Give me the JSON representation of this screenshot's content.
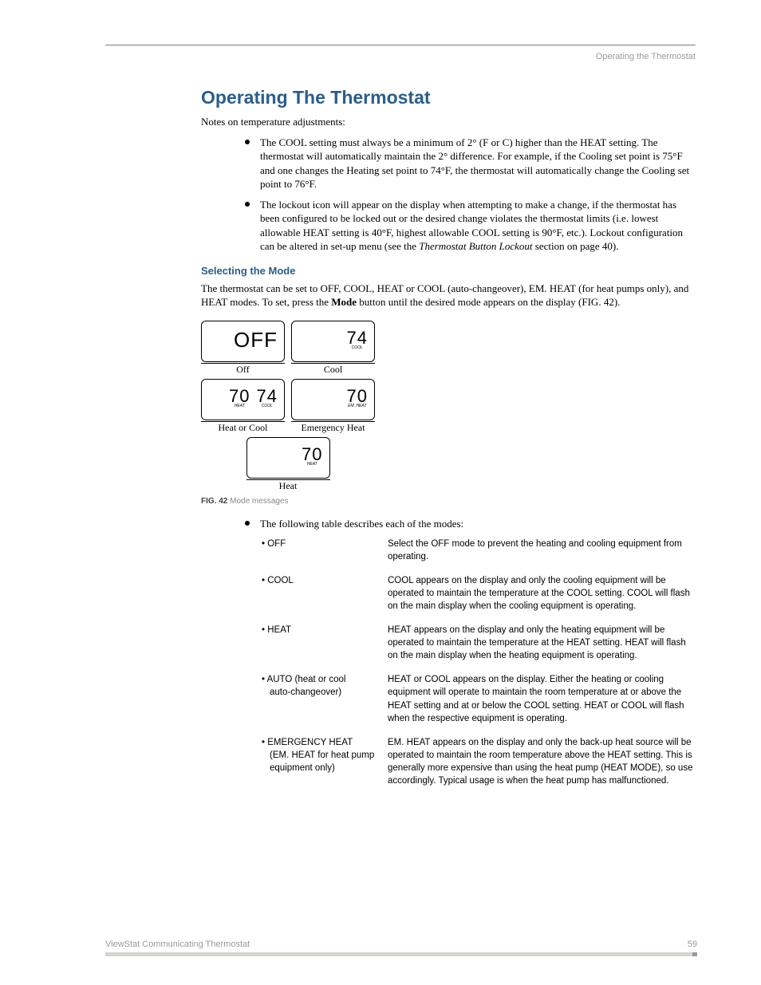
{
  "header": {
    "running_title": "Operating the Thermostat"
  },
  "title": "Operating The Thermostat",
  "intro": "Notes on temperature adjustments:",
  "bullets": [
    "The COOL setting must always be a minimum of 2° (F or C) higher than the HEAT setting. The thermostat will automatically maintain the 2° difference. For example, if the Cooling set point is 75°F and one changes the Heating set point to 74°F, the thermostat will automatically change the Cooling set point to 76°F.",
    "The lockout icon will appear on the display when attempting to make a change, if the thermostat has been configured to be locked out or the desired change violates the thermostat limits (i.e. lowest allowable HEAT setting is 40°F, highest allowable COOL setting is 90°F, etc.). Lockout configuration can be altered in set-up menu (see the ",
    " section on page 40)."
  ],
  "bullet2_italic": "Thermostat Button Lockout",
  "section2_heading": "Selecting the Mode",
  "section2_p1a": "The thermostat can be set to OFF, COOL, HEAT or COOL (auto-changeover), EM. HEAT (for heat pumps only), and HEAT modes. To set, press the ",
  "section2_p1b": "Mode",
  "section2_p1c": " button until the desired mode appears on the display (FIG. 42).",
  "figure": {
    "cells": {
      "off": {
        "display": "OFF",
        "label": "Off"
      },
      "cool": {
        "display": "74",
        "sublabel": "COOL",
        "label": "Cool"
      },
      "heatcool": {
        "left": "70",
        "left_sub": "HEAT",
        "right": "74",
        "right_sub": "COOL",
        "label": "Heat or Cool"
      },
      "emergency": {
        "display": "70",
        "sublabel": "EM. HEAT",
        "label": "Emergency Heat"
      },
      "heat": {
        "display": "70",
        "sublabel": "HEAT",
        "label": "Heat"
      }
    },
    "caption_bold": "FIG. 42",
    "caption_rest": "  Mode messages"
  },
  "table_intro": "The following table describes each of the modes:",
  "modes": [
    {
      "name": "• OFF",
      "name_cont": "",
      "desc": "Select the OFF mode to prevent the heating and cooling equipment from operating."
    },
    {
      "name": "• COOL",
      "name_cont": "",
      "desc": "COOL appears on the display and only the cooling equipment will be operated to maintain the temperature at the COOL setting. COOL will flash on the main display when the cooling equipment is operating."
    },
    {
      "name": "• HEAT",
      "name_cont": "",
      "desc": "HEAT appears on the display and only the heating equipment will be operated to maintain the temperature at the HEAT setting. HEAT will flash on the main display when the heating equipment is operating."
    },
    {
      "name": "• AUTO (heat or cool",
      "name_cont": "auto-changeover)",
      "desc": "HEAT or COOL appears on the display. Either the heating or cooling equipment will operate to maintain the room temperature at or above the HEAT setting and at or below the COOL setting. HEAT or COOL will flash when the respective equipment is operating."
    },
    {
      "name": "• EMERGENCY HEAT",
      "name_cont": "(EM. HEAT for heat pump equipment only)",
      "desc": "EM. HEAT appears on the display and only the back-up heat source will be operated to maintain the room temperature above the HEAT setting. This is generally more expensive than using the heat pump (HEAT MODE), so use accordingly. Typical usage is when the heat pump has malfunctioned."
    }
  ],
  "footer": {
    "left": "ViewStat Communicating Thermostat",
    "right": "59"
  }
}
